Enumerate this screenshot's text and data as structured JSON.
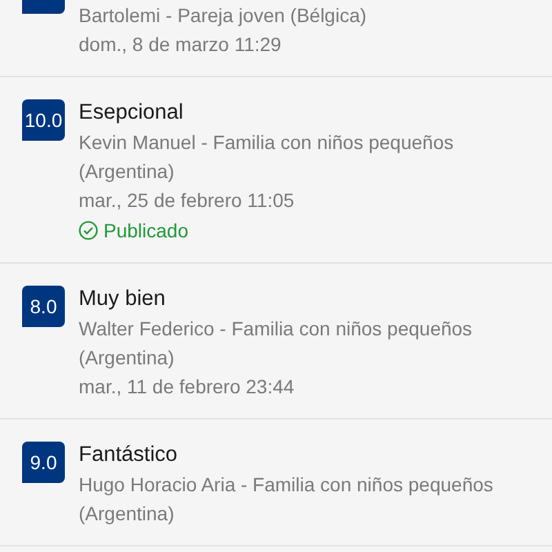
{
  "reviews": [
    {
      "author": "Bartolemi - Pareja joven (Bélgica)",
      "date": "dom., 8 de marzo 11:29"
    },
    {
      "score": "10.0",
      "title": "Esepcional",
      "author": "Kevin Manuel - Familia con niños pequeños (Argentina)",
      "date": "mar., 25 de febrero 11:05",
      "status": "Publicado"
    },
    {
      "score": "8.0",
      "title": "Muy bien",
      "author": "Walter Federico - Familia con niños pequeños (Argentina)",
      "date": "mar., 11 de febrero 23:44"
    },
    {
      "score": "9.0",
      "title": "Fantástico",
      "author": "Hugo Horacio Aria - Familia con niños pequeños (Argentina)"
    }
  ]
}
